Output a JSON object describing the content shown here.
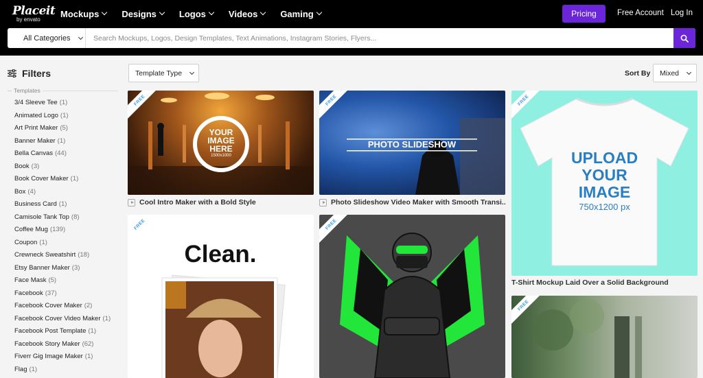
{
  "brand": {
    "name": "Placeit",
    "sub": "by envato"
  },
  "nav": {
    "items": [
      {
        "label": "Mockups"
      },
      {
        "label": "Designs"
      },
      {
        "label": "Logos"
      },
      {
        "label": "Videos"
      },
      {
        "label": "Gaming"
      }
    ],
    "pricing": "Pricing",
    "free_account": "Free Account",
    "login": "Log In"
  },
  "search": {
    "category": "All Categories",
    "placeholder": "Search Mockups, Logos, Design Templates, Text Animations, Instagram Stories, Flyers..."
  },
  "sidebar": {
    "title": "Filters",
    "section": "Templates",
    "items": [
      {
        "label": "3/4 Sleeve Tee",
        "count": "(1)"
      },
      {
        "label": "Animated Logo",
        "count": "(1)"
      },
      {
        "label": "Art Print Maker",
        "count": "(5)"
      },
      {
        "label": "Banner Maker",
        "count": "(1)"
      },
      {
        "label": "Bella Canvas",
        "count": "(44)"
      },
      {
        "label": "Book",
        "count": "(3)"
      },
      {
        "label": "Book Cover Maker",
        "count": "(1)"
      },
      {
        "label": "Box",
        "count": "(4)"
      },
      {
        "label": "Business Card",
        "count": "(1)"
      },
      {
        "label": "Camisole Tank Top",
        "count": "(8)"
      },
      {
        "label": "Coffee Mug",
        "count": "(139)"
      },
      {
        "label": "Coupon",
        "count": "(1)"
      },
      {
        "label": "Crewneck Sweatshirt",
        "count": "(18)"
      },
      {
        "label": "Etsy Banner Maker",
        "count": "(3)"
      },
      {
        "label": "Face Mask",
        "count": "(5)"
      },
      {
        "label": "Facebook",
        "count": "(37)"
      },
      {
        "label": "Facebook Cover Maker",
        "count": "(2)"
      },
      {
        "label": "Facebook Cover Video Maker",
        "count": "(1)"
      },
      {
        "label": "Facebook Post Template",
        "count": "(1)"
      },
      {
        "label": "Facebook Story Maker",
        "count": "(62)"
      },
      {
        "label": "Fiverr Gig Image Maker",
        "count": "(1)"
      },
      {
        "label": "Flag",
        "count": "(1)"
      }
    ]
  },
  "toolbar": {
    "template_type": "Template Type",
    "sort_label": "Sort By",
    "sort_value": "Mixed"
  },
  "cards": {
    "ribbon": "FREE",
    "c1": {
      "title": "Cool Intro Maker with a Bold Style",
      "overlay": "YOUR IMAGE HERE",
      "overlay_sub": "1500x1000"
    },
    "c2": {
      "title": "Photo Slideshow Video Maker with Smooth Transi...",
      "overlay": "PHOTO SLIDESHOW"
    },
    "c3": {
      "title": "T-Shirt Mockup Laid Over a Solid Background",
      "overlay": "UPLOAD YOUR IMAGE",
      "overlay_sub": "750x1200 px"
    },
    "c4": {
      "overlay": "Clean."
    },
    "c5": {},
    "c6": {}
  },
  "colors": {
    "accent": "#6b26d9",
    "ribbon_text": "#3a9de0"
  }
}
